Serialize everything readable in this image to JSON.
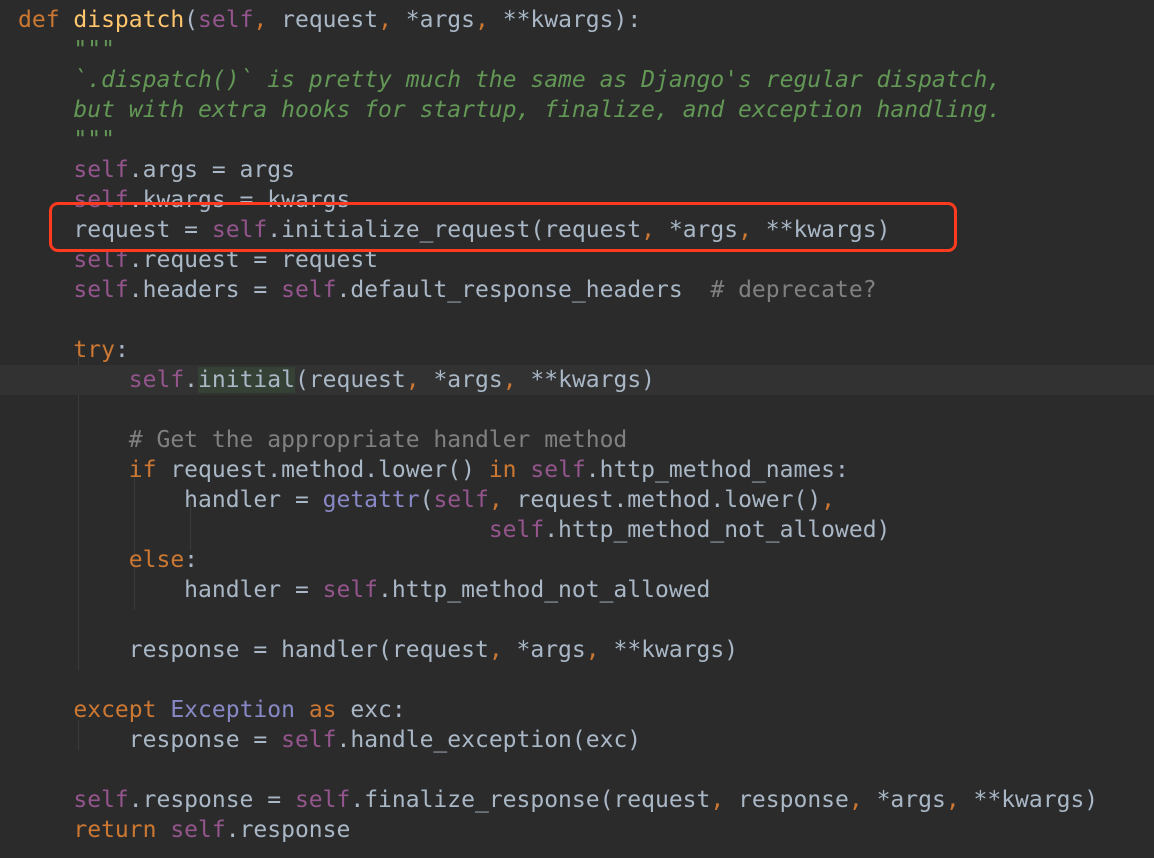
{
  "editor": {
    "lines": [
      [
        {
          "t": "def ",
          "c": "kw"
        },
        {
          "t": "dispatch",
          "c": "fn"
        },
        {
          "t": "(",
          "c": "op"
        },
        {
          "t": "self",
          "c": "self"
        },
        {
          "t": ", ",
          "c": "kw"
        },
        {
          "t": "request",
          "c": "op"
        },
        {
          "t": ", ",
          "c": "kw"
        },
        {
          "t": "*args",
          "c": "op"
        },
        {
          "t": ", ",
          "c": "kw"
        },
        {
          "t": "**kwargs",
          "c": "op"
        },
        {
          "t": "):",
          "c": "op"
        }
      ],
      [
        {
          "t": "    \"\"\"",
          "c": "doc"
        }
      ],
      [
        {
          "t": "    `.dispatch()` is pretty much the same as Django's regular dispatch,",
          "c": "doc"
        }
      ],
      [
        {
          "t": "    but with extra hooks for startup, finalize, and exception handling.",
          "c": "doc"
        }
      ],
      [
        {
          "t": "    \"\"\"",
          "c": "doc"
        }
      ],
      [
        {
          "t": "    ",
          "c": "op"
        },
        {
          "t": "self",
          "c": "self"
        },
        {
          "t": ".args = args",
          "c": "op"
        }
      ],
      [
        {
          "t": "    ",
          "c": "op"
        },
        {
          "t": "self",
          "c": "self"
        },
        {
          "t": ".kwargs = kwargs",
          "c": "op"
        }
      ],
      [
        {
          "t": "    request = ",
          "c": "op"
        },
        {
          "t": "self",
          "c": "self"
        },
        {
          "t": ".initialize_request(request",
          "c": "op"
        },
        {
          "t": ", ",
          "c": "kw"
        },
        {
          "t": "*args",
          "c": "op"
        },
        {
          "t": ", ",
          "c": "kw"
        },
        {
          "t": "**kwargs)",
          "c": "op"
        }
      ],
      [
        {
          "t": "    ",
          "c": "op"
        },
        {
          "t": "self",
          "c": "self"
        },
        {
          "t": ".request = request",
          "c": "op"
        }
      ],
      [
        {
          "t": "    ",
          "c": "op"
        },
        {
          "t": "self",
          "c": "self"
        },
        {
          "t": ".headers = ",
          "c": "op"
        },
        {
          "t": "self",
          "c": "self"
        },
        {
          "t": ".default_response_headers  ",
          "c": "op"
        },
        {
          "t": "# deprecate?",
          "c": "cmt"
        }
      ],
      [],
      [
        {
          "t": "    ",
          "c": "op"
        },
        {
          "t": "try",
          "c": "kw"
        },
        {
          "t": ":",
          "c": "op"
        }
      ],
      [
        {
          "t": "        ",
          "c": "op"
        },
        {
          "t": "self",
          "c": "self"
        },
        {
          "t": ".",
          "c": "op"
        },
        {
          "t": "initial",
          "c": "usage"
        },
        {
          "t": "(request",
          "c": "op"
        },
        {
          "t": ", ",
          "c": "kw"
        },
        {
          "t": "*args",
          "c": "op"
        },
        {
          "t": ", ",
          "c": "kw"
        },
        {
          "t": "**kwargs)",
          "c": "op"
        }
      ],
      [],
      [
        {
          "t": "        ",
          "c": "op"
        },
        {
          "t": "# Get the appropriate handler method",
          "c": "cmt"
        }
      ],
      [
        {
          "t": "        ",
          "c": "op"
        },
        {
          "t": "if ",
          "c": "kw"
        },
        {
          "t": "request.method.lower() ",
          "c": "op"
        },
        {
          "t": "in ",
          "c": "kw"
        },
        {
          "t": "self",
          "c": "self"
        },
        {
          "t": ".http_method_names:",
          "c": "op"
        }
      ],
      [
        {
          "t": "            handler = ",
          "c": "op"
        },
        {
          "t": "getattr",
          "c": "bi"
        },
        {
          "t": "(",
          "c": "op"
        },
        {
          "t": "self",
          "c": "self"
        },
        {
          "t": ", ",
          "c": "kw"
        },
        {
          "t": "request.method.lower()",
          "c": "op"
        },
        {
          "t": ",",
          "c": "kw"
        }
      ],
      [
        {
          "t": "                                  ",
          "c": "op"
        },
        {
          "t": "self",
          "c": "self"
        },
        {
          "t": ".http_method_not_allowed)",
          "c": "op"
        }
      ],
      [
        {
          "t": "        ",
          "c": "op"
        },
        {
          "t": "else",
          "c": "kw"
        },
        {
          "t": ":",
          "c": "op"
        }
      ],
      [
        {
          "t": "            handler = ",
          "c": "op"
        },
        {
          "t": "self",
          "c": "self"
        },
        {
          "t": ".http_method_not_allowed",
          "c": "op"
        }
      ],
      [],
      [
        {
          "t": "        response = handler(request",
          "c": "op"
        },
        {
          "t": ", ",
          "c": "kw"
        },
        {
          "t": "*args",
          "c": "op"
        },
        {
          "t": ", ",
          "c": "kw"
        },
        {
          "t": "**kwargs)",
          "c": "op"
        }
      ],
      [],
      [
        {
          "t": "    ",
          "c": "op"
        },
        {
          "t": "except ",
          "c": "kw"
        },
        {
          "t": "Exception ",
          "c": "cls"
        },
        {
          "t": "as ",
          "c": "kw"
        },
        {
          "t": "exc:",
          "c": "op"
        }
      ],
      [
        {
          "t": "        response = ",
          "c": "op"
        },
        {
          "t": "self",
          "c": "self"
        },
        {
          "t": ".handle_exception(exc)",
          "c": "op"
        }
      ],
      [],
      [
        {
          "t": "    ",
          "c": "op"
        },
        {
          "t": "self",
          "c": "self"
        },
        {
          "t": ".response = ",
          "c": "op"
        },
        {
          "t": "self",
          "c": "self"
        },
        {
          "t": ".finalize_response(request",
          "c": "op"
        },
        {
          "t": ", ",
          "c": "kw"
        },
        {
          "t": "response",
          "c": "op"
        },
        {
          "t": ", ",
          "c": "kw"
        },
        {
          "t": "*args",
          "c": "op"
        },
        {
          "t": ", ",
          "c": "kw"
        },
        {
          "t": "**kwargs)",
          "c": "op"
        }
      ],
      [
        {
          "t": "    ",
          "c": "op"
        },
        {
          "t": "return ",
          "c": "kw"
        },
        {
          "t": "self",
          "c": "self"
        },
        {
          "t": ".response",
          "c": "op"
        }
      ]
    ],
    "current_line_index": 12,
    "highlighted_line_index": 7,
    "colors": {
      "background": "#2b2b2b",
      "keyword": "#cc7832",
      "function_name": "#ffc66d",
      "self": "#94558d",
      "docstring": "#629755",
      "comment": "#808080",
      "text": "#a9b7c6",
      "highlight_box": "#ff3b1f"
    }
  }
}
